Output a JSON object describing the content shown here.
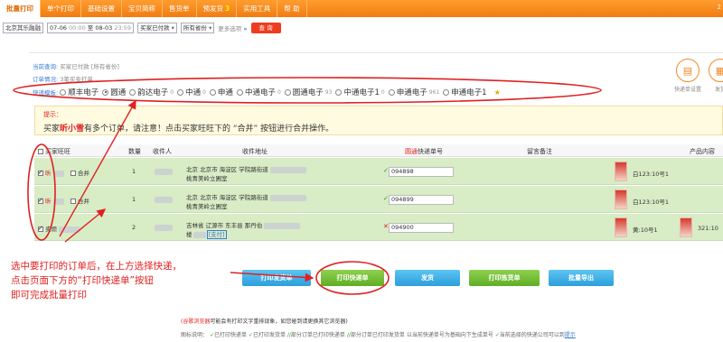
{
  "nav": {
    "tabs": [
      "批量打印",
      "单个打印",
      "基础设置",
      "宝贝简称",
      "售货单",
      "预发货",
      "实用工具",
      "帮 助"
    ],
    "badge": "3",
    "corner": "2"
  },
  "filters": {
    "shop": "北京其乐融融",
    "date_from": "07-06",
    "time_from": "00:00",
    "to_label": "至",
    "date_to": "08-03",
    "time_to": "23:59",
    "status": "买家已付款",
    "province": "所有省份",
    "more": "更多选项",
    "more_arrow": "»",
    "query": "查 询"
  },
  "info": {
    "current_query_label": "当前查询:",
    "current_query_value": "买家已付款 [所有省份]",
    "order_status_label": "订单情况:",
    "order_status_value": "3笔买卖打单",
    "express_label": "快递模板:",
    "express_options": [
      {
        "name": "顺丰电子",
        "count": "",
        "selected": false
      },
      {
        "name": "圆通",
        "count": "",
        "selected": true
      },
      {
        "name": "韵达电子",
        "count": "0",
        "selected": false
      },
      {
        "name": "中通",
        "count": "0",
        "selected": false
      },
      {
        "name": "申通",
        "count": "",
        "selected": false
      },
      {
        "name": "中通电子",
        "count": "0",
        "selected": false
      },
      {
        "name": "圆通电子",
        "count": "93",
        "selected": false
      },
      {
        "name": "中通电子1",
        "count": "0",
        "selected": false
      },
      {
        "name": "申通电子",
        "count": "961",
        "selected": false
      },
      {
        "name": "申通电子1",
        "count": "",
        "selected": false
      }
    ],
    "icon1_label": "快递单设置",
    "icon2_label": "发货"
  },
  "tip": {
    "title": "提示：",
    "pre": "买家",
    "buyer": "昕小雪",
    "post": "有多个订单，请注意！点击买家旺旺下的 “合并” 按钮进行合并操作。"
  },
  "table": {
    "headers": {
      "buyer": "买家旺旺",
      "qty": "数量",
      "receiver": "收件人",
      "address": "收件地址",
      "courier": "圆通",
      "waybill": "快递单号",
      "remark": "留言备注",
      "product": "产品内容"
    },
    "rows": [
      {
        "buyer": "昕",
        "merge": "合并",
        "qty": "1",
        "addr1": "北京 北京市 海淀区 学院路街道",
        "addr2": "桃青美岭立圃室",
        "waybill": "094898",
        "status": "ok",
        "spec": "白123:10号1",
        "spec2": ""
      },
      {
        "buyer": "昕",
        "merge": "合并",
        "qty": "1",
        "addr1": "北京 北京市 海淀区 学院路街道",
        "addr2": "桃青美岭立圃室",
        "waybill": "094899",
        "status": "ok",
        "spec": "白123:10号1",
        "spec2": ""
      },
      {
        "buyer": "卖烦",
        "merge": "",
        "qty": "2",
        "addr1": "吉林省 辽源市 东丰县 那丹伯",
        "addr2": "楼",
        "addr_badge": "[支付]",
        "waybill": "094900",
        "status": "x",
        "spec": "黄:10号1",
        "spec2": "321:10"
      }
    ]
  },
  "annotation": {
    "line1": "选中要打印的订单后，在上方选择快递，",
    "line2": "点击页面下方的“打印快递单”按钮",
    "line3": "即可完成批量打印"
  },
  "buttons": {
    "print_invoice": "打印发货单",
    "print_express": "打印快递单",
    "ship": "发货",
    "print_pick": "打印拣货单",
    "export": "批量导出"
  },
  "footer": {
    "f1_red": "(谷歌浏览器",
    "f1_rest": "可能会有打印文字重排现象，如您碰到请更换其它浏览器)",
    "f2_label": "图标说明：",
    "f2_l1": "已打印快递单",
    "f2_l2": "已打印发货单",
    "f2_l3": "部分订单已打印快递单",
    "f2_l4": "部分订单已打印发货单 以当前快递单号为基础向下生成单号",
    "f2_l5": "当前选择的快递公司可以到",
    "f2_link": "提示"
  },
  "colors": {
    "accent": "#f07c12",
    "red": "#e02020",
    "row_green": "#d8ecc6",
    "blue_btn": "#2c9fdb",
    "green_btn": "#5fae25"
  }
}
